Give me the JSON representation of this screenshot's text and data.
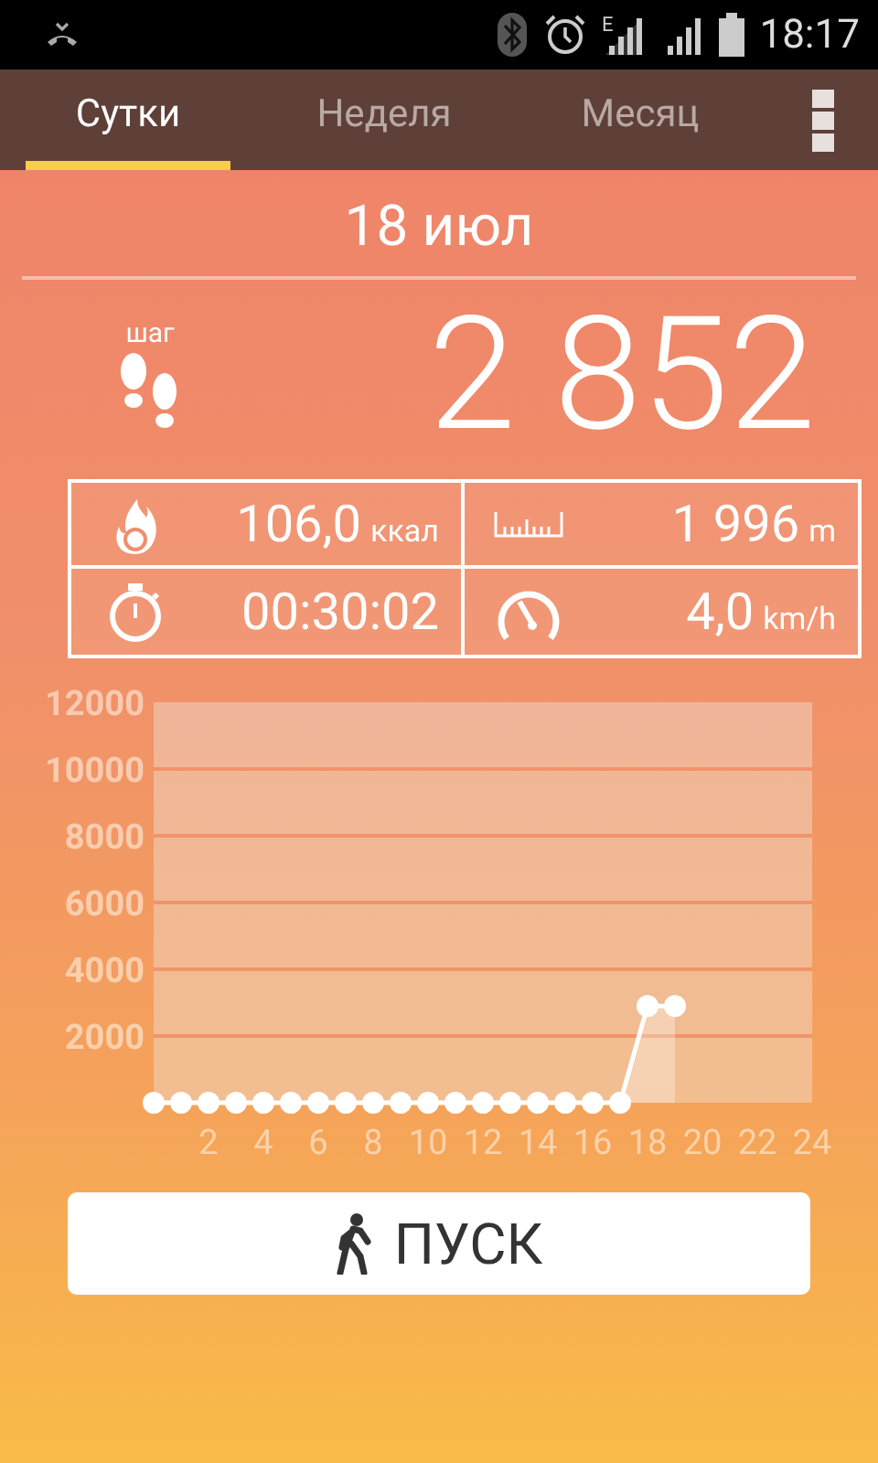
{
  "status_bar": {
    "network_type": "E",
    "time": "18:17"
  },
  "tabs": [
    {
      "label": "Сутки",
      "selected": true
    },
    {
      "label": "Неделя",
      "selected": false
    },
    {
      "label": "Месяц",
      "selected": false
    }
  ],
  "date": "18 июл",
  "steps": {
    "label": "шаг",
    "value": "2 852"
  },
  "stats": [
    {
      "kind": "calories",
      "value": "106,0",
      "unit": "ккал"
    },
    {
      "kind": "distance",
      "value": "1 996",
      "unit": "m"
    },
    {
      "kind": "time",
      "value": "00:30:02"
    },
    {
      "kind": "speed",
      "value": "4,0",
      "unit": "km/h"
    }
  ],
  "chart": {
    "chart_data": {
      "type": "area",
      "x": [
        0,
        1,
        2,
        3,
        4,
        5,
        6,
        7,
        8,
        9,
        10,
        11,
        12,
        13,
        14,
        15,
        16,
        17,
        18,
        19
      ],
      "grid": true,
      "series": [
        {
          "color": "#ffffff",
          "marker": "circle",
          "values": [
            0,
            0,
            0,
            0,
            0,
            0,
            0,
            0,
            0,
            0,
            0,
            0,
            0,
            0,
            0,
            0,
            0,
            0,
            2900,
            2900
          ]
        }
      ],
      "xlim": [
        0,
        24
      ],
      "ylim": [
        0,
        12000
      ],
      "xticks": [
        2,
        4,
        6,
        8,
        10,
        12,
        14,
        16,
        18,
        20,
        22,
        24
      ],
      "yticks": [
        2000,
        4000,
        6000,
        8000,
        10000,
        12000
      ]
    }
  },
  "start_button": {
    "label": "ПУСК"
  }
}
